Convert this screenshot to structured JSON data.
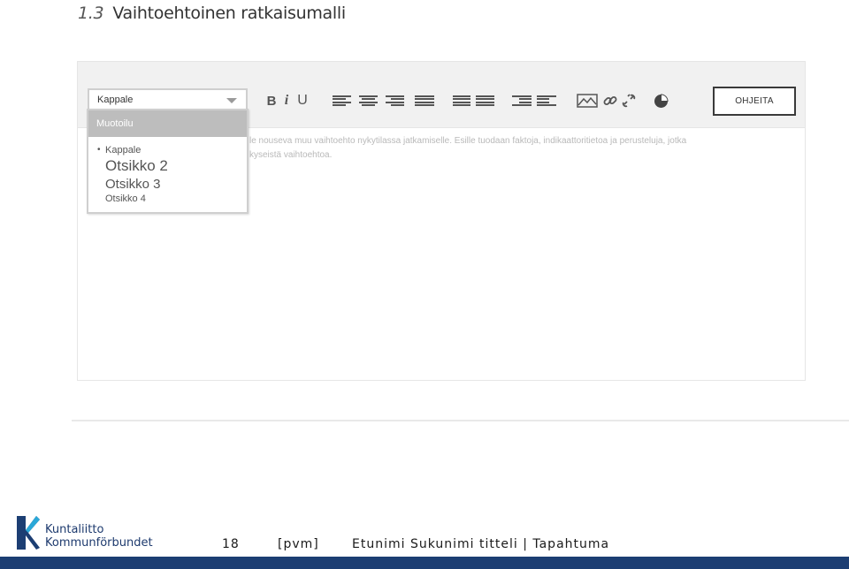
{
  "section": {
    "number": "1.3",
    "title": "Vaihtoehtoinen ratkaisumalli"
  },
  "toolbar": {
    "format_select_value": "Kappale",
    "bold_label": "B",
    "italic_label": "i",
    "underline_label": "U",
    "help_label": "OHJEITA"
  },
  "editor": {
    "placeholder_line1": "le nouseva muu vaihtoehto nykytilassa jatkamiselle. Esille tuodaan faktoja, indikaattoritietoa ja perusteluja, jotka",
    "placeholder_line2": "kyseistä vaihtoehtoa."
  },
  "dropdown": {
    "header": "Muotoilu",
    "items": [
      "Kappale",
      "Otsikko 2",
      "Otsikko 3",
      "Otsikko 4"
    ]
  },
  "footer": {
    "logo_line1": "Kuntaliitto",
    "logo_line2": "Kommunförbundet",
    "page_number": "18",
    "date": "[pvm]",
    "author": "Etunimi Sukunimi titteli | Tapahtuma"
  },
  "colors": {
    "brand": "#1c3e73",
    "dropdown_header": "#bdbdbd"
  }
}
